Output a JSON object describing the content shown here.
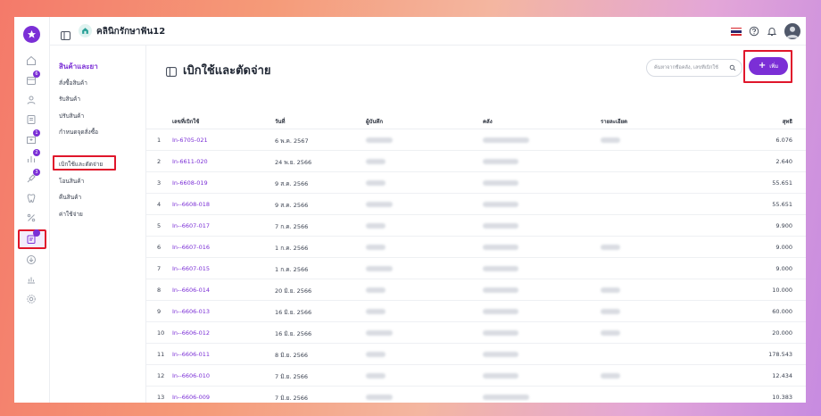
{
  "topbar": {
    "clinic_name": "คลินิกรักษาฟัน12"
  },
  "rail": {
    "badges": [
      "6",
      "1",
      "2",
      "3"
    ]
  },
  "subnav": {
    "title": "สินค้าและยา",
    "items": [
      "สั่งซื้อสินค้า",
      "รับสินค้า",
      "ปรับสินค้า",
      "กำหนดจุดสั่งซื้อ",
      "เบิกใช้และตัดจ่าย",
      "โอนสินค้า",
      "คืนสินค้า",
      "ค่าใช้จ่าย"
    ]
  },
  "main": {
    "title": "เบิกใช้และตัดจ่าย",
    "search_placeholder": "ค้นหาจากชื่อคลัง, เลขที่เบิกใช้",
    "add_label": "เพิ่ม"
  },
  "table": {
    "columns": [
      "เลขที่เบิกใช้",
      "วันที่",
      "ผู้บันทึก",
      "คลัง",
      "รายละเอียด",
      "สุทธิ"
    ],
    "rows": [
      {
        "no": "1",
        "doc": "In-6705-021",
        "date": "6 พ.ค. 2567",
        "detail_shown": true,
        "net": "6.076"
      },
      {
        "no": "2",
        "doc": "In-6611-020",
        "date": "24 พ.ย. 2566",
        "detail_shown": false,
        "net": "2.640"
      },
      {
        "no": "3",
        "doc": "In-6608-019",
        "date": "9 ส.ค. 2566",
        "detail_shown": false,
        "net": "55.651"
      },
      {
        "no": "4",
        "doc": "In--6608-018",
        "date": "9 ส.ค. 2566",
        "detail_shown": false,
        "net": "55.651"
      },
      {
        "no": "5",
        "doc": "In--6607-017",
        "date": "7 ก.ค. 2566",
        "detail_shown": false,
        "net": "9.900"
      },
      {
        "no": "6",
        "doc": "In--6607-016",
        "date": "1 ก.ค. 2566",
        "detail_shown": true,
        "net": "9.000"
      },
      {
        "no": "7",
        "doc": "In--6607-015",
        "date": "1 ก.ค. 2566",
        "detail_shown": false,
        "net": "9.000"
      },
      {
        "no": "8",
        "doc": "In--6606-014",
        "date": "20 มิ.ย. 2566",
        "detail_shown": true,
        "net": "10.000"
      },
      {
        "no": "9",
        "doc": "In--6606-013",
        "date": "16 มิ.ย. 2566",
        "detail_shown": true,
        "net": "60.000"
      },
      {
        "no": "10",
        "doc": "In--6606-012",
        "date": "16 มิ.ย. 2566",
        "detail_shown": true,
        "net": "20.000"
      },
      {
        "no": "11",
        "doc": "In--6606-011",
        "date": "8 มิ.ย. 2566",
        "detail_shown": false,
        "net": "178.543"
      },
      {
        "no": "12",
        "doc": "In--6606-010",
        "date": "7 มิ.ย. 2566",
        "detail_shown": true,
        "net": "12.434"
      },
      {
        "no": "13",
        "doc": "In--6606-009",
        "date": "7 มิ.ย. 2566",
        "detail_shown": false,
        "net": "10.383"
      }
    ]
  },
  "colors": {
    "accent": "#7b2fd6",
    "highlight": "#e0162b"
  }
}
